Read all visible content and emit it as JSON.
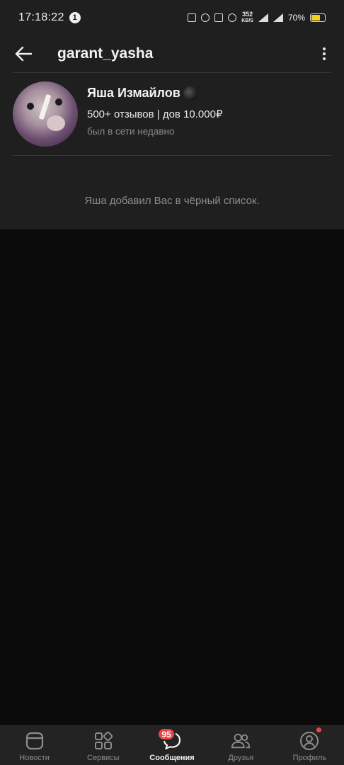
{
  "status_bar": {
    "time": "17:18:22",
    "notification_count": "1",
    "net_speed_value": "352",
    "net_speed_unit": "KB/S",
    "battery_percent": "70%",
    "battery_level": 0.7,
    "battery_color": "#f2d21b"
  },
  "header": {
    "title": "garant_yasha",
    "back_icon": "arrow-left-icon",
    "menu_icon": "more-vertical-icon"
  },
  "profile": {
    "name": "Яша Измайлов",
    "meta": "500+ отзывов | дов 10.000₽",
    "last_seen": "был в сети недавно"
  },
  "notice": {
    "text": "Яша добавил Вас в чёрный список."
  },
  "bottom_nav": {
    "items": [
      {
        "label": "Новости",
        "icon": "news-icon"
      },
      {
        "label": "Сервисы",
        "icon": "services-icon"
      },
      {
        "label": "Сообщения",
        "icon": "messages-icon",
        "badge": "95",
        "active": true
      },
      {
        "label": "Друзья",
        "icon": "friends-icon"
      },
      {
        "label": "Профиль",
        "icon": "profile-icon"
      }
    ]
  },
  "colors": {
    "background": "#0b0b0b",
    "panel": "#1f1f1f",
    "badge": "#e64646"
  }
}
